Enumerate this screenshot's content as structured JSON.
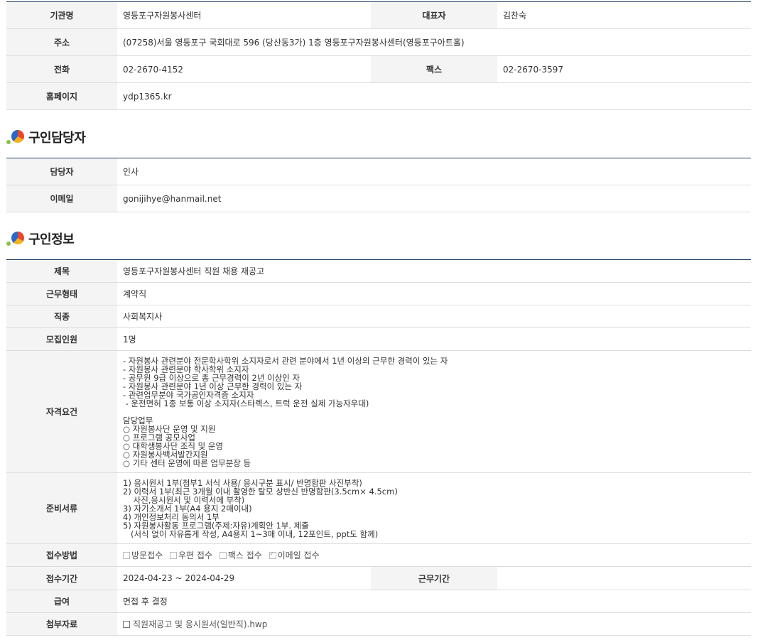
{
  "org": {
    "name_label": "기관명",
    "name": "영등포구자원봉사센터",
    "rep_label": "대표자",
    "rep": "김찬숙",
    "address_label": "주소",
    "address": "(07258)서울 영등포구 국회대로 596 (당산동3가) 1층 영등포구자원봉사센터(영등포구아트홀)",
    "phone_label": "전화",
    "phone": "02-2670-4152",
    "fax_label": "팩스",
    "fax": "02-2670-3597",
    "homepage_label": "홈페이지",
    "homepage": "ydp1365.kr"
  },
  "contact_section": {
    "title": "구인담당자",
    "manager_label": "담당자",
    "manager": "인사",
    "email_label": "이메일",
    "email": "gonijihye@hanmail.net"
  },
  "job_section": {
    "title": "구인정보",
    "subject_label": "제목",
    "subject": "영등포구자원봉사센터 직원 채용 재공고",
    "worktype_label": "근무형태",
    "worktype": "계약직",
    "jobtype_label": "직종",
    "jobtype": "사회복지사",
    "headcount_label": "모집인원",
    "headcount": "1명",
    "qualification_label": "자격요건",
    "qualification_lines": [
      "- 자원봉사 관련분야 전문학사학위 소지자로서 관련 분야에서 1년 이상의 근무한 경력이 있는 자",
      "- 자원봉사 관련분야 학사학위 소지자",
      "- 공무원 9급 이상으로 총 근무경력이 2년 이상인 자",
      "- 자원봉사 관련분야 1년 이상 근무한 경력이 있는 자",
      "- 관련업무분야 국가공인자격증 소지자",
      " - 운전면허 1종 보통 이상 소지자(스타렉스, 트럭 운전 실제 가능자우대)",
      "",
      "담당업무",
      "○ 자원봉사단 운영 및 지원",
      "○ 프로그램 공모사업",
      "○ 대학생봉사단 조직 및 운영",
      "○ 자원봉사백서발간지원",
      "○ 기타 센터 운영에 따른 업무분장 등"
    ],
    "documents_label": "준비서류",
    "documents_lines": [
      "1) 응시원서 1부(첨부1 서식 사용/ 응시구분 표시/ 반명함판 사진부착)",
      "2) 이력서 1부(최근 3개월 이내 촬영한 탈모 상반신 반명함판(3.5cm× 4.5cm)",
      "    사진,응시원서 및 이력서에 부착)",
      "3) 자기소개서 1부(A4 용지 2매이내)",
      "4) 개인정보처리 동의서 1부",
      "5) 자원봉사활동 프로그램(주제:자유)계획안 1부. 제출",
      "   (서식 없이 자유롭게 작성, A4용지 1~3매 이내, 12포인트, ppt도 함께)"
    ],
    "method_label": "접수방법",
    "methods": [
      {
        "label": "방문접수",
        "checked": false
      },
      {
        "label": "우편 접수",
        "checked": false
      },
      {
        "label": "팩스 접수",
        "checked": false
      },
      {
        "label": "이메일 접수",
        "checked": true
      }
    ],
    "period_label": "접수기간",
    "period": "2024-04-23 ~ 2024-04-29",
    "workperiod_label": "근무기간",
    "workperiod": "",
    "salary_label": "급여",
    "salary": "면접 후 결정",
    "attachment_label": "첨부자료",
    "attachment": "직원재공고 및 응시원서(일반직).hwp",
    "attachment_icon": "file-icon"
  }
}
